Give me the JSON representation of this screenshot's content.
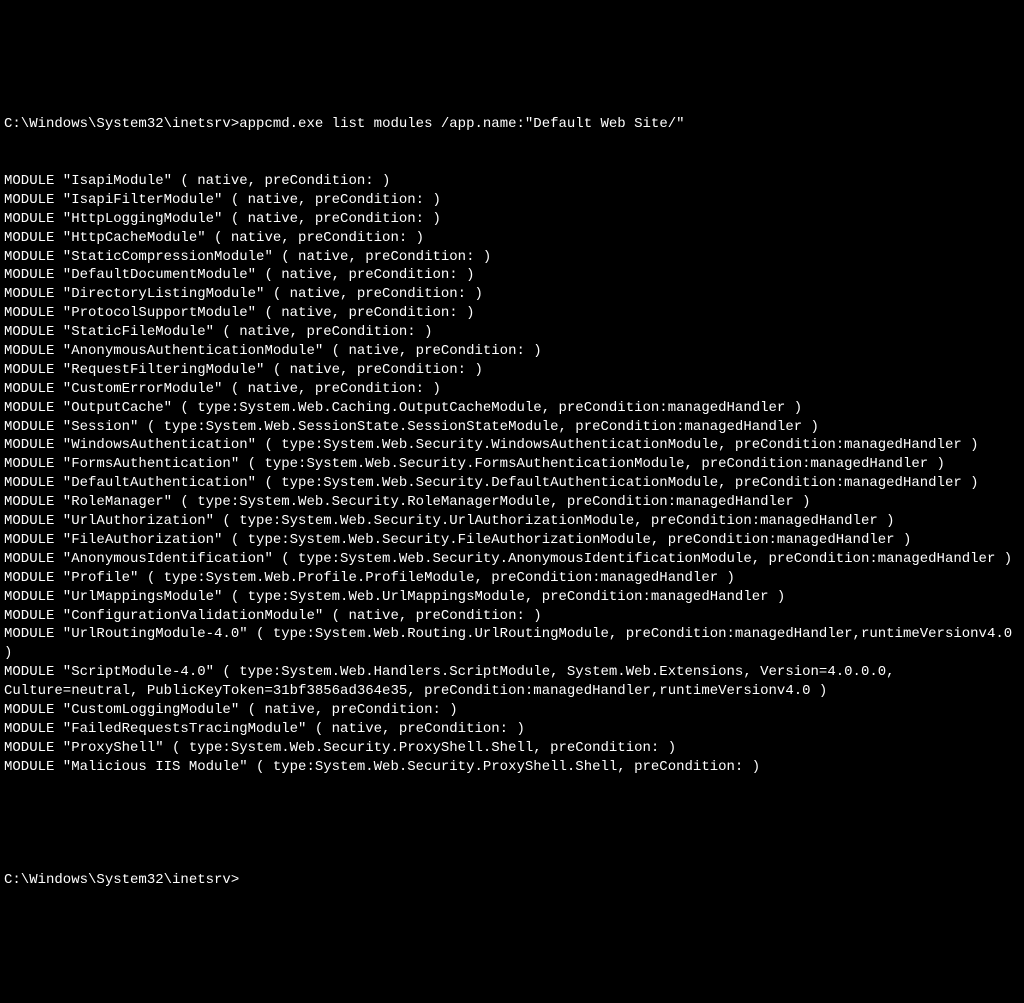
{
  "terminal": {
    "prompt_path": "C:\\Windows\\System32\\inetsrv>",
    "command": "appcmd.exe list modules /app.name:\"Default Web Site/\"",
    "output_lines": [
      "MODULE \"IsapiModule\" ( native, preCondition: )",
      "MODULE \"IsapiFilterModule\" ( native, preCondition: )",
      "MODULE \"HttpLoggingModule\" ( native, preCondition: )",
      "MODULE \"HttpCacheModule\" ( native, preCondition: )",
      "MODULE \"StaticCompressionModule\" ( native, preCondition: )",
      "MODULE \"DefaultDocumentModule\" ( native, preCondition: )",
      "MODULE \"DirectoryListingModule\" ( native, preCondition: )",
      "MODULE \"ProtocolSupportModule\" ( native, preCondition: )",
      "MODULE \"StaticFileModule\" ( native, preCondition: )",
      "MODULE \"AnonymousAuthenticationModule\" ( native, preCondition: )",
      "MODULE \"RequestFilteringModule\" ( native, preCondition: )",
      "MODULE \"CustomErrorModule\" ( native, preCondition: )",
      "MODULE \"OutputCache\" ( type:System.Web.Caching.OutputCacheModule, preCondition:managedHandler )",
      "MODULE \"Session\" ( type:System.Web.SessionState.SessionStateModule, preCondition:managedHandler )",
      "MODULE \"WindowsAuthentication\" ( type:System.Web.Security.WindowsAuthenticationModule, preCondition:managedHandler )",
      "MODULE \"FormsAuthentication\" ( type:System.Web.Security.FormsAuthenticationModule, preCondition:managedHandler )",
      "MODULE \"DefaultAuthentication\" ( type:System.Web.Security.DefaultAuthenticationModule, preCondition:managedHandler )",
      "MODULE \"RoleManager\" ( type:System.Web.Security.RoleManagerModule, preCondition:managedHandler )",
      "MODULE \"UrlAuthorization\" ( type:System.Web.Security.UrlAuthorizationModule, preCondition:managedHandler )",
      "MODULE \"FileAuthorization\" ( type:System.Web.Security.FileAuthorizationModule, preCondition:managedHandler )",
      "MODULE \"AnonymousIdentification\" ( type:System.Web.Security.AnonymousIdentificationModule, preCondition:managedHandler )",
      "MODULE \"Profile\" ( type:System.Web.Profile.ProfileModule, preCondition:managedHandler )",
      "MODULE \"UrlMappingsModule\" ( type:System.Web.UrlMappingsModule, preCondition:managedHandler )",
      "MODULE \"ConfigurationValidationModule\" ( native, preCondition: )",
      "MODULE \"UrlRoutingModule-4.0\" ( type:System.Web.Routing.UrlRoutingModule, preCondition:managedHandler,runtimeVersionv4.0 )",
      "MODULE \"ScriptModule-4.0\" ( type:System.Web.Handlers.ScriptModule, System.Web.Extensions, Version=4.0.0.0, Culture=neutral, PublicKeyToken=31bf3856ad364e35, preCondition:managedHandler,runtimeVersionv4.0 )",
      "MODULE \"CustomLoggingModule\" ( native, preCondition: )",
      "MODULE \"FailedRequestsTracingModule\" ( native, preCondition: )",
      "MODULE \"ProxyShell\" ( type:System.Web.Security.ProxyShell.Shell, preCondition: )",
      "MODULE \"Malicious IIS Module\" ( type:System.Web.Security.ProxyShell.Shell, preCondition: )"
    ],
    "final_prompt": "C:\\Windows\\System32\\inetsrv>"
  }
}
